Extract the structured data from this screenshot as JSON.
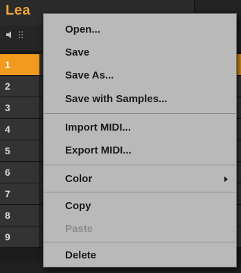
{
  "panel": {
    "title": "Lea",
    "rows": [
      {
        "num": "1",
        "active": true
      },
      {
        "num": "2",
        "active": false
      },
      {
        "num": "3",
        "active": false
      },
      {
        "num": "4",
        "active": false
      },
      {
        "num": "5",
        "active": false
      },
      {
        "num": "6",
        "active": false
      },
      {
        "num": "7",
        "active": false
      },
      {
        "num": "8",
        "active": false
      },
      {
        "num": "9",
        "active": false
      }
    ],
    "icons": {
      "speaker": "speaker-icon",
      "grip": "grip-icon"
    },
    "colors": {
      "accent": "#f29a1e",
      "title": "#f2a33a"
    }
  },
  "context_menu": {
    "items": [
      {
        "label": "Open...",
        "enabled": true
      },
      {
        "label": "Save",
        "enabled": true
      },
      {
        "label": "Save As...",
        "enabled": true
      },
      {
        "label": "Save with Samples...",
        "enabled": true
      },
      {
        "label": "Import MIDI...",
        "enabled": true
      },
      {
        "label": "Export MIDI...",
        "enabled": true
      },
      {
        "label": "Color",
        "enabled": true,
        "submenu": true
      },
      {
        "label": "Copy",
        "enabled": true
      },
      {
        "label": "Paste",
        "enabled": false
      },
      {
        "label": "Delete",
        "enabled": true
      }
    ],
    "colors": {
      "background": "#b9b9b9",
      "text": "#1a1a1a",
      "disabled_text": "#8c8c8c"
    }
  }
}
